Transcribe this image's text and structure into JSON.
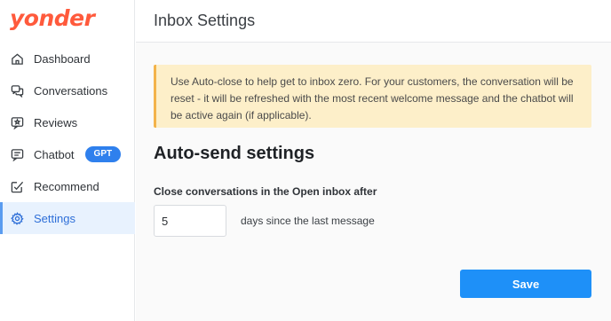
{
  "app": {
    "logo_text": "yonder",
    "brand_color": "#ff5a3c",
    "accent_color": "#1e90f8"
  },
  "sidebar": {
    "items": [
      {
        "label": "Dashboard",
        "icon": "home-icon",
        "active": false
      },
      {
        "label": "Conversations",
        "icon": "chat-bubbles-icon",
        "active": false
      },
      {
        "label": "Reviews",
        "icon": "star-icon",
        "active": false
      },
      {
        "label": "Chatbot",
        "icon": "message-icon",
        "active": false,
        "badge": "GPT"
      },
      {
        "label": "Recommend",
        "icon": "edit-check-icon",
        "active": false
      },
      {
        "label": "Settings",
        "icon": "gear-icon",
        "active": true
      }
    ]
  },
  "header": {
    "title": "Inbox Settings"
  },
  "notice": {
    "text": "Use Auto-close to help get to inbox zero. For your customers, the conversation will be reset - it will be refreshed with the most recent welcome message and the chatbot will be active again (if applicable)."
  },
  "autosend": {
    "title": "Auto-send settings",
    "field_label": "Close conversations in the Open inbox after",
    "value": "5",
    "suffix": "days since the last message"
  },
  "actions": {
    "save_label": "Save"
  }
}
